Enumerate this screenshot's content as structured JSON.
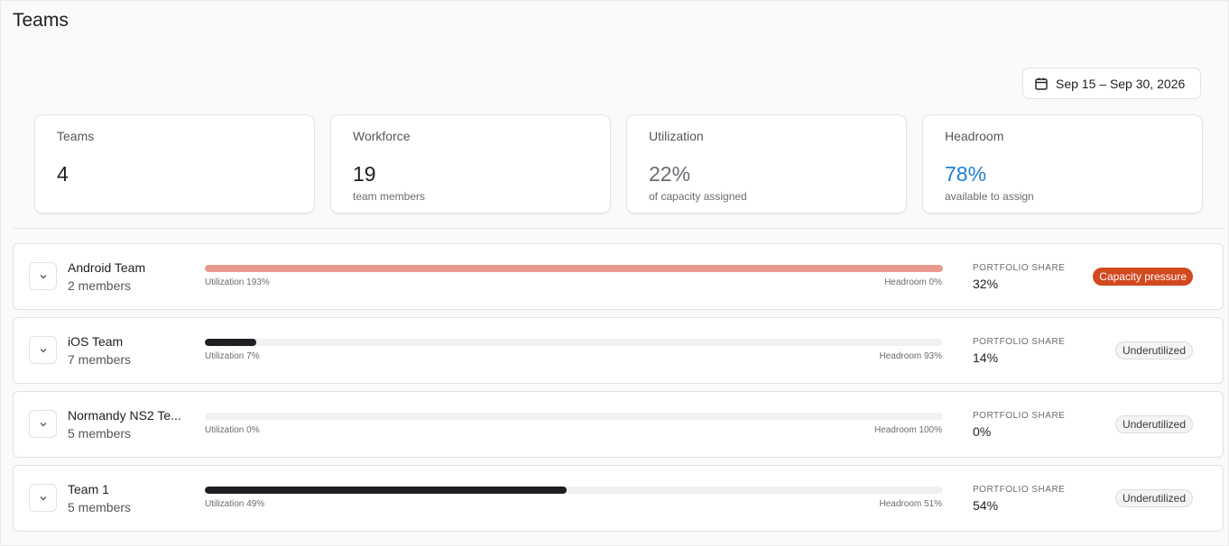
{
  "page": {
    "title": "Teams"
  },
  "date_range": {
    "label": "Sep 15 – Sep 30, 2026"
  },
  "stats": [
    {
      "label": "Teams",
      "value": "4",
      "sub": "",
      "color": "#1f1f23"
    },
    {
      "label": "Workforce",
      "value": "19",
      "sub": "team members",
      "color": "#1f1f23"
    },
    {
      "label": "Utilization",
      "value": "22%",
      "sub": "of capacity assigned",
      "color": "#6b6b72"
    },
    {
      "label": "Headroom",
      "value": "78%",
      "sub": "available to assign",
      "color": "#1f7fd6"
    }
  ],
  "teams": [
    {
      "name": "Android Team",
      "members": "2 members",
      "utilization": 193,
      "util_label": "Utilization 193%",
      "headroom_label": "Headroom 0%",
      "share_title": "PORTFOLIO SHARE",
      "share": "32%",
      "badge": "Capacity pressure",
      "badge_type": "pressure"
    },
    {
      "name": "iOS Team",
      "members": "7 members",
      "utilization": 7,
      "util_label": "Utilization 7%",
      "headroom_label": "Headroom 93%",
      "share_title": "PORTFOLIO SHARE",
      "share": "14%",
      "badge": "Underutilized",
      "badge_type": "under"
    },
    {
      "name": "Normandy NS2 Te...",
      "members": "5 members",
      "utilization": 0,
      "util_label": "Utilization 0%",
      "headroom_label": "Headroom 100%",
      "share_title": "PORTFOLIO SHARE",
      "share": "0%",
      "badge": "Underutilized",
      "badge_type": "under"
    },
    {
      "name": "Team 1",
      "members": "5 members",
      "utilization": 49,
      "util_label": "Utilization 49%",
      "headroom_label": "Headroom 51%",
      "share_title": "PORTFOLIO SHARE",
      "share": "54%",
      "badge": "Underutilized",
      "badge_type": "under"
    }
  ]
}
